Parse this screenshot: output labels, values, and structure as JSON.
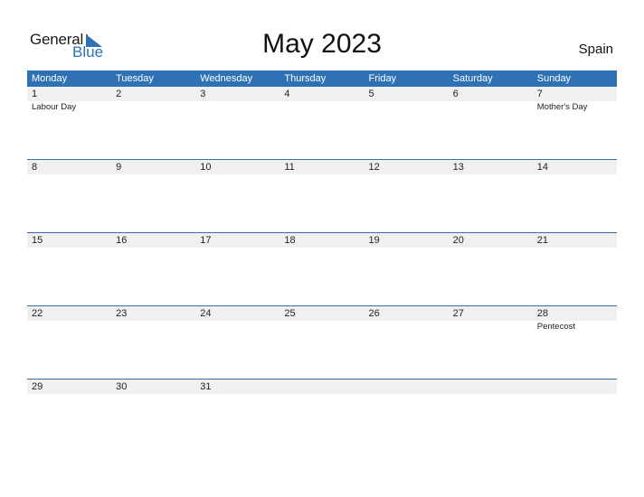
{
  "logo": {
    "general": "General",
    "blue": "Blue"
  },
  "title": "May 2023",
  "country": "Spain",
  "colors": {
    "accent": "#2e72b5",
    "band": "#f0f0f0"
  },
  "weekdays": [
    "Monday",
    "Tuesday",
    "Wednesday",
    "Thursday",
    "Friday",
    "Saturday",
    "Sunday"
  ],
  "weeks": [
    [
      {
        "day": "1",
        "holiday": "Labour Day"
      },
      {
        "day": "2",
        "holiday": ""
      },
      {
        "day": "3",
        "holiday": ""
      },
      {
        "day": "4",
        "holiday": ""
      },
      {
        "day": "5",
        "holiday": ""
      },
      {
        "day": "6",
        "holiday": ""
      },
      {
        "day": "7",
        "holiday": "Mother's Day"
      }
    ],
    [
      {
        "day": "8",
        "holiday": ""
      },
      {
        "day": "9",
        "holiday": ""
      },
      {
        "day": "10",
        "holiday": ""
      },
      {
        "day": "11",
        "holiday": ""
      },
      {
        "day": "12",
        "holiday": ""
      },
      {
        "day": "13",
        "holiday": ""
      },
      {
        "day": "14",
        "holiday": ""
      }
    ],
    [
      {
        "day": "15",
        "holiday": ""
      },
      {
        "day": "16",
        "holiday": ""
      },
      {
        "day": "17",
        "holiday": ""
      },
      {
        "day": "18",
        "holiday": ""
      },
      {
        "day": "19",
        "holiday": ""
      },
      {
        "day": "20",
        "holiday": ""
      },
      {
        "day": "21",
        "holiday": ""
      }
    ],
    [
      {
        "day": "22",
        "holiday": ""
      },
      {
        "day": "23",
        "holiday": ""
      },
      {
        "day": "24",
        "holiday": ""
      },
      {
        "day": "25",
        "holiday": ""
      },
      {
        "day": "26",
        "holiday": ""
      },
      {
        "day": "27",
        "holiday": ""
      },
      {
        "day": "28",
        "holiday": "Pentecost"
      }
    ],
    [
      {
        "day": "29",
        "holiday": ""
      },
      {
        "day": "30",
        "holiday": ""
      },
      {
        "day": "31",
        "holiday": ""
      },
      {
        "day": "",
        "holiday": ""
      },
      {
        "day": "",
        "holiday": ""
      },
      {
        "day": "",
        "holiday": ""
      },
      {
        "day": "",
        "holiday": ""
      }
    ]
  ]
}
